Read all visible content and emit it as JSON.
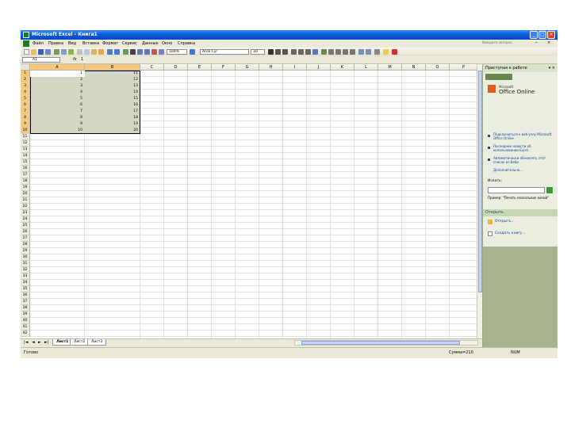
{
  "window": {
    "title": "Microsoft Excel - Книга1",
    "minimize_label": "_",
    "maximize_label": "□",
    "close_label": "×"
  },
  "menubar": {
    "items": [
      "Файл",
      "Правка",
      "Вид",
      "Вставка",
      "Формат",
      "Сервис",
      "Данные",
      "Окно",
      "Справка"
    ],
    "help_placeholder": "Введите вопрос",
    "doc_min": "−",
    "doc_close": "× "
  },
  "toolbar": {
    "zoom": "100%",
    "font": "Arial Cyr",
    "font_size": "10"
  },
  "formula_bar": {
    "cell_ref": "A1",
    "fx": "fx",
    "value": "1"
  },
  "grid": {
    "columns": [
      "A",
      "B",
      "C",
      "D",
      "E",
      "F",
      "G",
      "H",
      "I",
      "J",
      "K",
      "L",
      "M",
      "N",
      "O",
      "P"
    ],
    "rows": [
      "1",
      "2",
      "3",
      "4",
      "5",
      "6",
      "7",
      "8",
      "9",
      "10",
      "11",
      "12",
      "13",
      "14",
      "15",
      "16",
      "17",
      "18",
      "19",
      "20",
      "21",
      "22",
      "23",
      "24",
      "25",
      "26",
      "27",
      "28",
      "29",
      "30",
      "31",
      "32",
      "33",
      "34",
      "35",
      "36",
      "37",
      "38",
      "39",
      "40",
      "41",
      "42"
    ],
    "col_a_values": [
      "1",
      "2",
      "3",
      "4",
      "5",
      "6",
      "7",
      "8",
      "9",
      "10"
    ],
    "col_b_values": [
      "11",
      "12",
      "13",
      "14",
      "15",
      "16",
      "17",
      "18",
      "19",
      "20"
    ]
  },
  "sheets": {
    "nav": [
      "|◄",
      "◄",
      "►",
      "►|"
    ],
    "tabs": [
      "Лист1",
      "Лист2",
      "Лист3"
    ]
  },
  "status": {
    "left": "Готово",
    "sum": "Сумма=210",
    "num": "NUM"
  },
  "task_pane": {
    "title": "Приступая к работе",
    "close": "▾ ×",
    "office_small": "Microsoft",
    "office_big": "Office Online",
    "links": [
      "Подключиться к веб-узлу Microsoft Office Online",
      "Последние новости об использовании Excel",
      "Автоматически обновлять этот список из Веба"
    ],
    "more": "Дополнительно...",
    "search_label": "Искать:",
    "example": "Пример: \"Печать нескольких копий\"",
    "open_section": "Открыть",
    "open_item": "Открыть...",
    "create_item": "Создать книгу..."
  }
}
